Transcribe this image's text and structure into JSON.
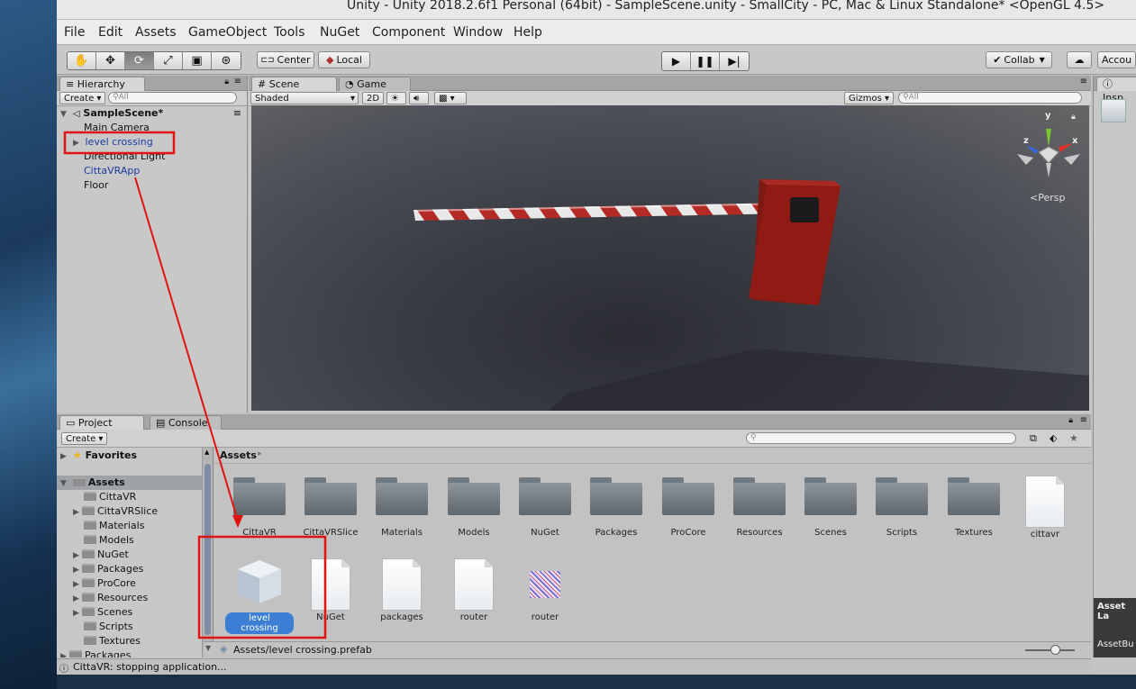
{
  "window_title": "Unity - Unity 2018.2.6f1 Personal (64bit) - SampleScene.unity - SmallCity - PC, Mac & Linux Standalone* <OpenGL 4.5>",
  "menu": [
    "File",
    "Edit",
    "Assets",
    "GameObject",
    "Tools",
    "NuGet",
    "Component",
    "Window",
    "Help"
  ],
  "toolbar": {
    "center_label": "Center",
    "local_label": "Local",
    "collab_label": "Collab",
    "account_label": "Accou"
  },
  "hierarchy": {
    "tab_label": "Hierarchy",
    "create_label": "Create",
    "search_placeholder": "All",
    "scene_name": "SampleScene*",
    "items": [
      "Main Camera",
      "level crossing",
      "Directional Light",
      "CittaVRApp",
      "Floor"
    ]
  },
  "scene": {
    "tab_scene": "Scene",
    "tab_game": "Game",
    "shading": "Shaded",
    "mode_2d": "2D",
    "gizmos_label": "Gizmos",
    "search_placeholder": "All",
    "persp_label": "Persp",
    "axis_x": "x",
    "axis_y": "y",
    "axis_z": "z"
  },
  "inspector": {
    "tab_label": "Insp",
    "asset_labels": "Asset La",
    "asset_bundle": "AssetBu"
  },
  "project": {
    "tab_project": "Project",
    "tab_console": "Console",
    "create_label": "Create",
    "favorites_label": "Favorites",
    "assets_root": "Assets",
    "folders": [
      "CittaVR",
      "CittaVRSlice",
      "Materials",
      "Models",
      "NuGet",
      "Packages",
      "ProCore",
      "Resources",
      "Scenes",
      "Scripts",
      "Textures"
    ],
    "more_folder": "Packages",
    "breadcrumb": "Assets",
    "grid_row1": [
      "CittaVR",
      "CittaVRSlice",
      "Materials",
      "Models",
      "NuGet",
      "Packages",
      "ProCore",
      "Resources",
      "Scenes",
      "Scripts",
      "Textures",
      "cittavr"
    ],
    "grid_row2": [
      "level crossing",
      "NuGet",
      "packages",
      "router",
      "router"
    ],
    "selected_path": "Assets/level crossing.prefab"
  },
  "status_text": "CittaVR: stopping application...",
  "colors": {
    "annotation_red": "#e11212",
    "selection_blue": "#3d7fd4",
    "prefab_blue": "#1c3a9e",
    "barrier_red": "#8f1b14"
  }
}
